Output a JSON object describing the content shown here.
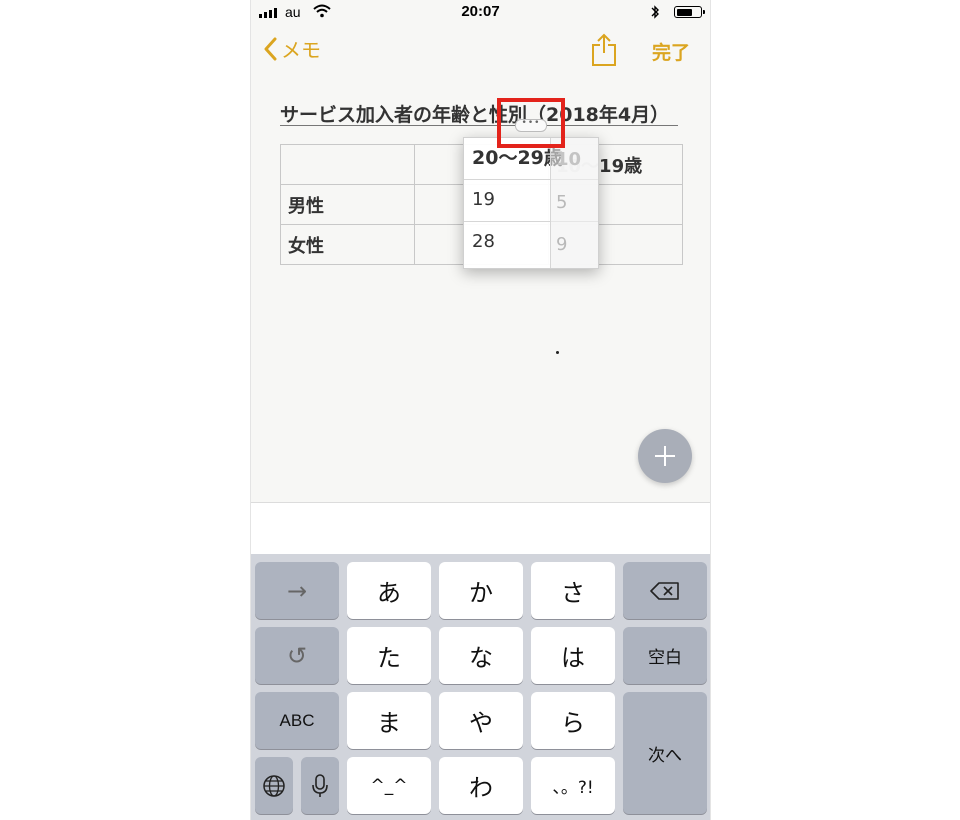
{
  "status_bar": {
    "carrier": "au",
    "time": "20:07",
    "battery_fraction": 0.7
  },
  "nav": {
    "back_label": "メモ",
    "done_label": "完了"
  },
  "note": {
    "title": "サービス加入者の年齢と性別（2018年4月）",
    "table": {
      "row_labels": [
        "男性",
        "女性"
      ],
      "last_column_header": "10〜19歳",
      "dragged_column": {
        "header": "20〜29歳",
        "values": [
          "19",
          "28"
        ]
      },
      "hidden_column_peek": {
        "header": "10",
        "values": [
          "5",
          "9"
        ]
      }
    },
    "drag_handle": "•••"
  },
  "keyboard": {
    "row1": [
      "→",
      "あ",
      "か",
      "さ",
      "⌫"
    ],
    "row2": [
      "↺",
      "た",
      "な",
      "は",
      "空白"
    ],
    "row3": [
      "ABC",
      "ま",
      "や",
      "ら",
      "次へ"
    ],
    "row4": [
      "globe",
      "mic",
      "^_^",
      "わ",
      "、。?!"
    ],
    "key_labels": {
      "next_arrow": "→",
      "undo": "↺",
      "abc": "ABC",
      "space": "空白",
      "enter": "次へ",
      "face": "^_^",
      "punct": "、。?!"
    }
  },
  "colors": {
    "accent": "#dba520",
    "highlight_box": "#e3231b",
    "keyboard_bg": "#d1d4db",
    "function_key": "#adb3bf"
  },
  "icons": {
    "back": "chevron-left-icon",
    "share": "share-icon",
    "add": "plus-icon",
    "globe": "globe-icon",
    "mic": "microphone-icon",
    "delete": "delete-backspace-icon"
  }
}
